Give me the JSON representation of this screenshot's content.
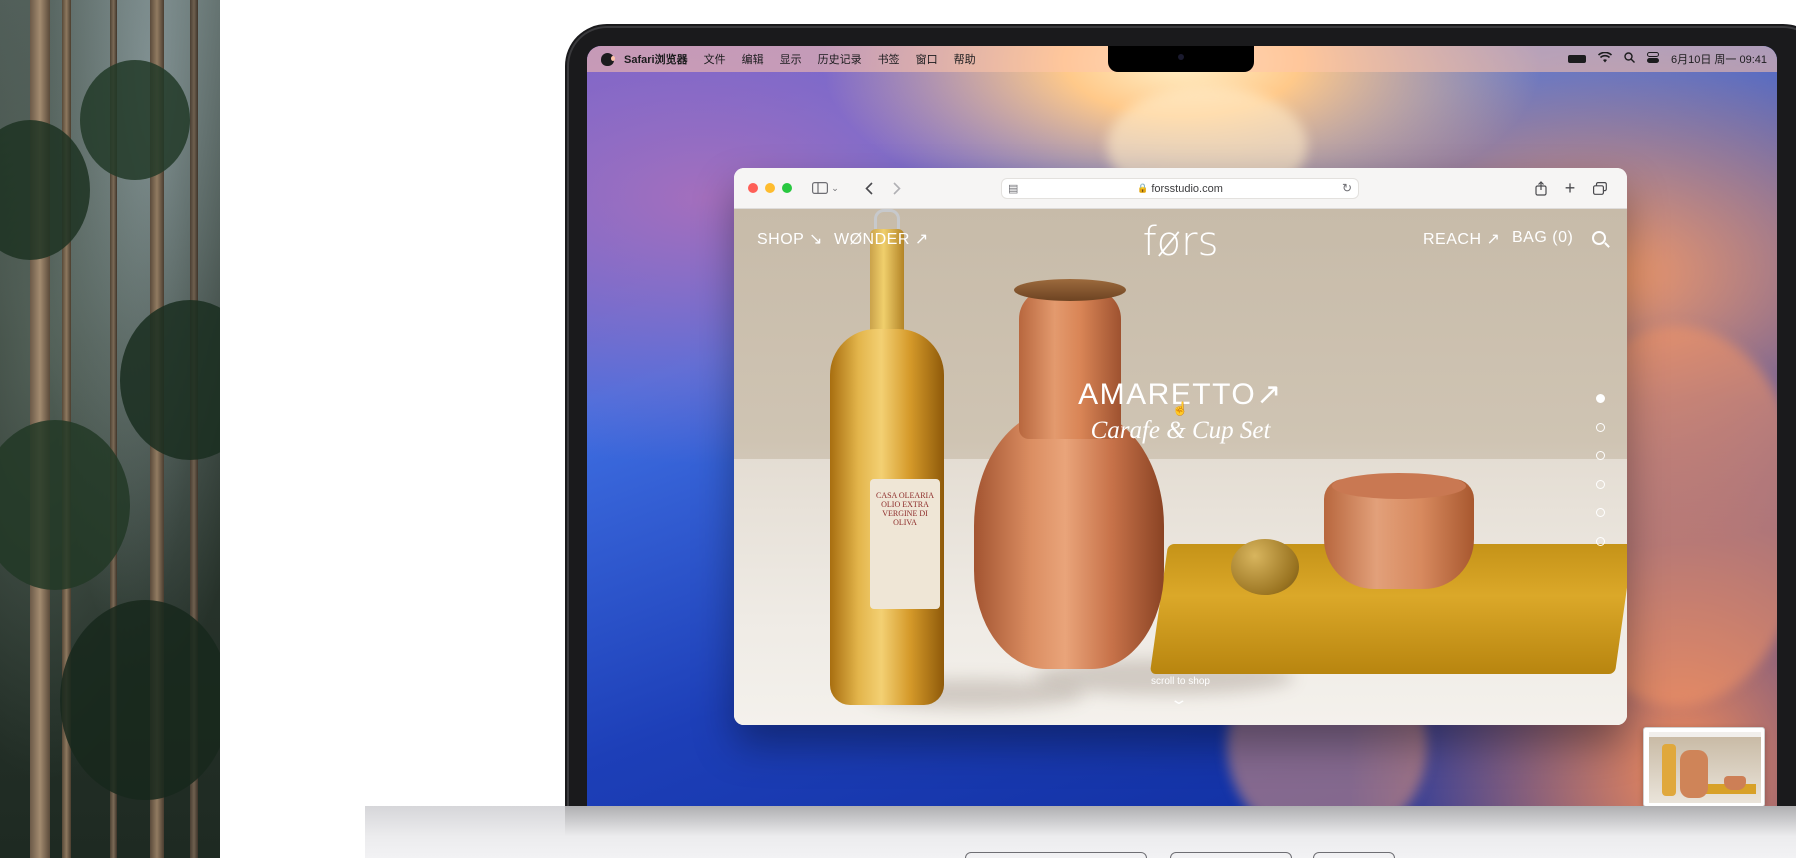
{
  "menubar": {
    "app_name": "Safari浏览器",
    "items": [
      "文件",
      "编辑",
      "显示",
      "历史记录",
      "书签",
      "窗口",
      "帮助"
    ],
    "clock": "6月10日 周一 09:41"
  },
  "browser": {
    "url": "forsstudio.com"
  },
  "site": {
    "logo": "førs",
    "nav_left": [
      "SHOP ↘",
      "WØNDER ↗"
    ],
    "nav_right": [
      "REACH ↗",
      "BAG (0)"
    ],
    "hero_title": "AMARETTO↗",
    "hero_subtitle": "Carafe & Cup Set",
    "scroll_hint": "scroll to shop",
    "carousel_active_index": 0,
    "carousel_count": 6,
    "bottle_label": "CASA OLEARIA OLIO EXTRA VERGINE DI OLIVA"
  },
  "icons": {
    "apple": "apple-logo-icon",
    "battery": "battery-icon",
    "wifi": "wifi-icon",
    "spotlight": "search-icon",
    "control_center": "control-center-icon",
    "sidebar": "sidebar-icon",
    "back": "chevron-left-icon",
    "forward": "chevron-right-icon",
    "share": "share-icon",
    "new_tab": "plus-icon",
    "tabs": "tab-overview-icon"
  },
  "colors": {
    "traffic_close": "#fe5f57",
    "traffic_min": "#febc2e",
    "traffic_max": "#28c840"
  }
}
